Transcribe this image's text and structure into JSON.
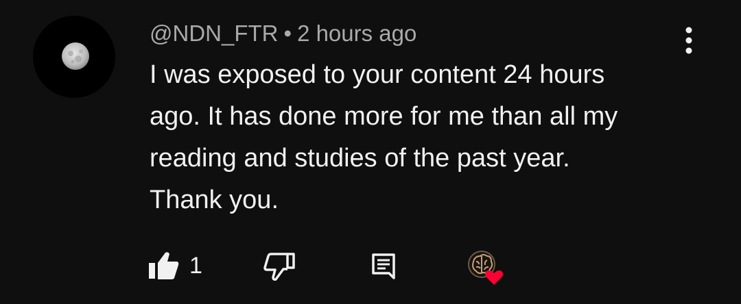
{
  "comment": {
    "author": "@NDN_FTR",
    "separator": "•",
    "timestamp": "2 hours ago",
    "text": "I was exposed to your content 24 hours\nago. It has done more for me than all my\nreading and studies of the past year.\nThank you.",
    "like_count": "1"
  },
  "icons": {
    "avatar": "moon-avatar",
    "menu": "more-vert-icon",
    "like": "thumbs-up-filled-icon",
    "dislike": "thumbs-down-outline-icon",
    "reply": "comment-reply-icon",
    "creator_heart": "brain-creator-heart-icon"
  },
  "colors": {
    "background": "#0f0f0f",
    "text": "#f1f1f1",
    "meta": "#aaaaaa",
    "heart": "#ff0033"
  }
}
